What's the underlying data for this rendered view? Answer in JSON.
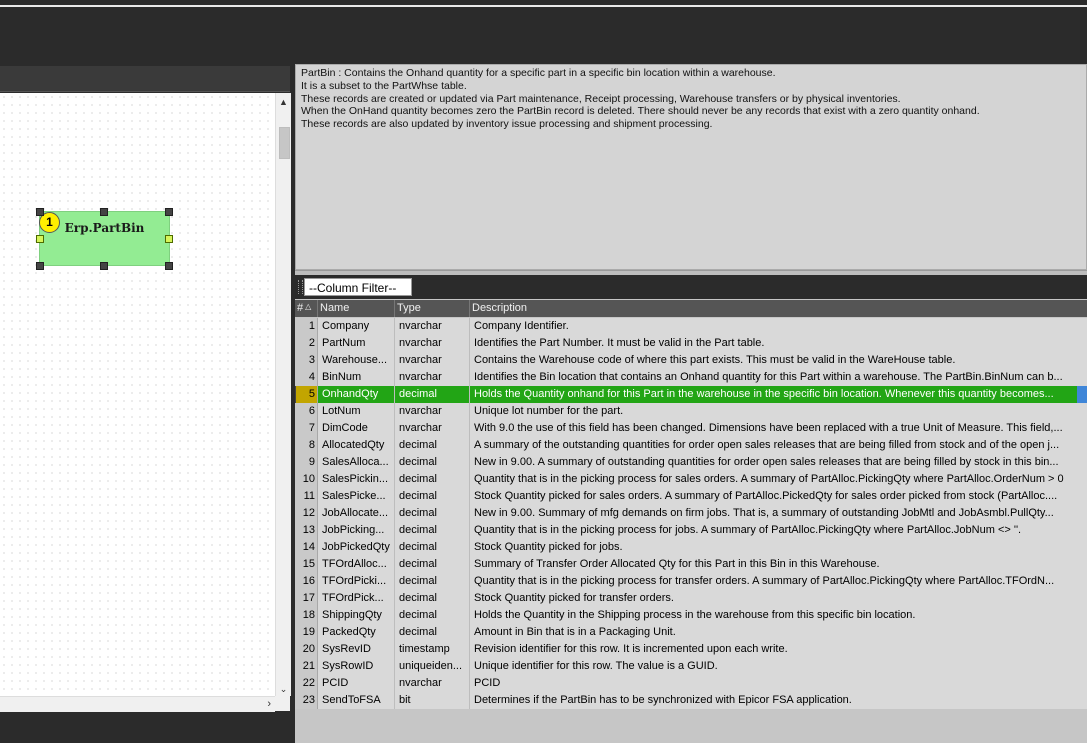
{
  "description": "PartBin : Contains the Onhand quantity for a specific part in a specific bin location within a warehouse.\nIt is a subset to the PartWhse table.\nThese records are created or updated via Part maintenance, Receipt processing, Warehouse transfers or by physical inventories.\nWhen the OnHand quantity becomes zero the PartBin record is deleted. There should never be any records that exist with a zero quantity onhand.\nThese records are also updated by inventory issue processing and shipment processing.",
  "diagram": {
    "entity_label": "Erp.PartBin",
    "badge": "1",
    "entity_color": "#93ec93"
  },
  "filter": {
    "value": "--Column Filter--"
  },
  "columns": {
    "num": "#",
    "sort_icon": "sort-ascending-icon",
    "name": "Name",
    "type": "Type",
    "desc": "Description"
  },
  "rows": [
    {
      "num": "1",
      "name": "Company",
      "type": "nvarchar",
      "desc": "Company Identifier."
    },
    {
      "num": "2",
      "name": "PartNum",
      "type": "nvarchar",
      "desc": "Identifies the Part Number. It must be valid in the Part table."
    },
    {
      "num": "3",
      "name": "Warehouse...",
      "type": "nvarchar",
      "desc": "Contains the Warehouse code of where this part exists. This must be valid in the WareHouse table."
    },
    {
      "num": "4",
      "name": "BinNum",
      "type": "nvarchar",
      "desc": "Identifies the Bin location that contains an Onhand quantity for this Part within a warehouse. The PartBin.BinNum can b..."
    },
    {
      "num": "5",
      "name": "OnhandQty",
      "type": "decimal",
      "desc": "Holds the Quantity onhand for this Part in the warehouse in the specific bin location.  Whenever this quantity becomes...",
      "selected": true
    },
    {
      "num": "6",
      "name": "LotNum",
      "type": "nvarchar",
      "desc": "Unique lot number for the part."
    },
    {
      "num": "7",
      "name": "DimCode",
      "type": "nvarchar",
      "desc": "With 9.0 the use of this field has been changed. Dimensions have been replaced with a true Unit of Measure. This field,..."
    },
    {
      "num": "8",
      "name": "AllocatedQty",
      "type": "decimal",
      "desc": "A summary of the outstanding quantities for order open sales releases that are being filled from stock and of the open j..."
    },
    {
      "num": "9",
      "name": "SalesAlloca...",
      "type": "decimal",
      "desc": "New in 9.00.  A summary of outstanding quantities for order open sales releases that are being filled by stock in this bin..."
    },
    {
      "num": "10",
      "name": "SalesPickin...",
      "type": "decimal",
      "desc": "Quantity that is in the picking process for sales orders. A summary of PartAlloc.PickingQty where PartAlloc.OrderNum > 0"
    },
    {
      "num": "11",
      "name": "SalesPicke...",
      "type": "decimal",
      "desc": "Stock Quantity picked for sales orders.  A summary of PartAlloc.PickedQty for sales order picked from stock  (PartAlloc...."
    },
    {
      "num": "12",
      "name": "JobAllocate...",
      "type": "decimal",
      "desc": "New in 9.00.  Summary of mfg demands on firm jobs. That is, a summary of outstanding JobMtl and JobAsmbl.PullQty..."
    },
    {
      "num": "13",
      "name": "JobPicking...",
      "type": "decimal",
      "desc": "Quantity that is in the picking process for jobs. A summary of PartAlloc.PickingQty where PartAlloc.JobNum <> ''."
    },
    {
      "num": "14",
      "name": "JobPickedQty",
      "type": "decimal",
      "desc": "Stock Quantity picked for jobs."
    },
    {
      "num": "15",
      "name": "TFOrdAlloc...",
      "type": "decimal",
      "desc": "Summary of Transfer Order Allocated Qty for this Part in this Bin in this Warehouse."
    },
    {
      "num": "16",
      "name": "TFOrdPicki...",
      "type": "decimal",
      "desc": "Quantity that is in the picking process for transfer orders.  A summary of PartAlloc.PickingQty where PartAlloc.TFOrdN..."
    },
    {
      "num": "17",
      "name": "TFOrdPick...",
      "type": "decimal",
      "desc": "Stock Quantity picked for transfer orders."
    },
    {
      "num": "18",
      "name": "ShippingQty",
      "type": "decimal",
      "desc": "Holds the Quantity in the Shipping process in the warehouse from this specific bin location."
    },
    {
      "num": "19",
      "name": "PackedQty",
      "type": "decimal",
      "desc": "Amount in Bin that is in a Packaging Unit."
    },
    {
      "num": "20",
      "name": "SysRevID",
      "type": "timestamp",
      "desc": "Revision identifier for this row. It is incremented upon each write."
    },
    {
      "num": "21",
      "name": "SysRowID",
      "type": "uniqueiden...",
      "desc": "Unique identifier for this row. The value is a GUID."
    },
    {
      "num": "22",
      "name": "PCID",
      "type": "nvarchar",
      "desc": "PCID"
    },
    {
      "num": "23",
      "name": "SendToFSA",
      "type": "bit",
      "desc": "Determines if the PartBin has to be synchronized with Epicor FSA application."
    }
  ]
}
